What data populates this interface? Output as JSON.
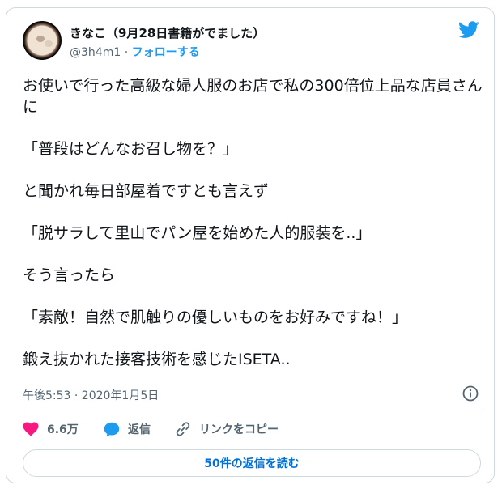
{
  "author": {
    "display_name": "きなこ（9月28日書籍がでました）",
    "handle": "@3h4m1",
    "separator": "·",
    "follow_label": "フォローする"
  },
  "tweet": {
    "text": "お使いで行った高級な婦人服のお店で私の300倍位上品な店員さんに\n\n「普段はどんなお召し物を？」\n\nと聞かれ毎日部屋着ですとも言えず\n\n「脱サラして里山でパン屋を始めた人的服装を..」\n\nそう言ったら\n\n「素敵！自然で肌触りの優しいものをお好みですね！」\n\n鍛え抜かれた接客技術を感じたISETA..",
    "timestamp": "午後5:53 · 2020年1月5日"
  },
  "actions": {
    "like_count": "6.6万",
    "reply_label": "返信",
    "copy_link_label": "リンクをコピー"
  },
  "footer": {
    "read_replies_label": "50件の返信を読む"
  },
  "icons": {
    "brand": "twitter-bird-icon",
    "info": "info-icon",
    "like": "heart-icon",
    "reply": "speech-bubble-icon",
    "copy": "link-icon"
  },
  "colors": {
    "accent": "#1d9bf0",
    "like": "#f91880",
    "muted": "#536471",
    "button_text": "#006fd6"
  }
}
